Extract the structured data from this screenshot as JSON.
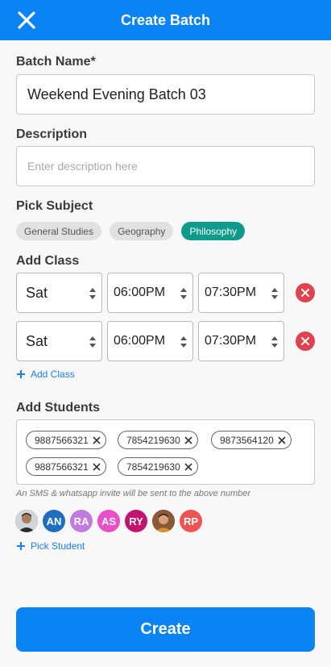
{
  "header": {
    "title": "Create Batch",
    "close_icon": "close-icon"
  },
  "batch_name": {
    "label": "Batch Name*",
    "value": "Weekend Evening Batch 03"
  },
  "description": {
    "label": "Description",
    "placeholder": "Enter description here",
    "value": ""
  },
  "subjects": {
    "label": "Pick Subject",
    "items": [
      {
        "label": "General Studies",
        "selected": false
      },
      {
        "label": "Geography",
        "selected": false
      },
      {
        "label": "Philosophy",
        "selected": true
      }
    ]
  },
  "classes": {
    "label": "Add Class",
    "rows": [
      {
        "day": "Sat",
        "start": "06:00PM",
        "end": "07:30PM"
      },
      {
        "day": "Sat",
        "start": "06:00PM",
        "end": "07:30PM"
      }
    ],
    "add_label": "Add Class"
  },
  "students": {
    "label": "Add Students",
    "numbers": [
      "9887566321",
      "7854219630",
      "9873564120",
      "9887566321",
      "7854219630"
    ],
    "hint": "An SMS & whatsapp invite will be sent to the above number",
    "avatars": [
      {
        "type": "photo",
        "initials": ""
      },
      {
        "type": "initials",
        "initials": "AN",
        "color": "#1e6fc2"
      },
      {
        "type": "initials",
        "initials": "RA",
        "color": "#c07be0"
      },
      {
        "type": "initials",
        "initials": "AS",
        "color": "#e84fc8"
      },
      {
        "type": "initials",
        "initials": "RY",
        "color": "#c4136f"
      },
      {
        "type": "photo",
        "initials": ""
      },
      {
        "type": "initials",
        "initials": "RP",
        "color": "#f05353"
      }
    ],
    "pick_label": "Pick Student"
  },
  "submit": {
    "label": "Create"
  },
  "colors": {
    "primary": "#0a84f4",
    "selected_chip": "#0f9b8b",
    "remove": "#e0434f"
  }
}
